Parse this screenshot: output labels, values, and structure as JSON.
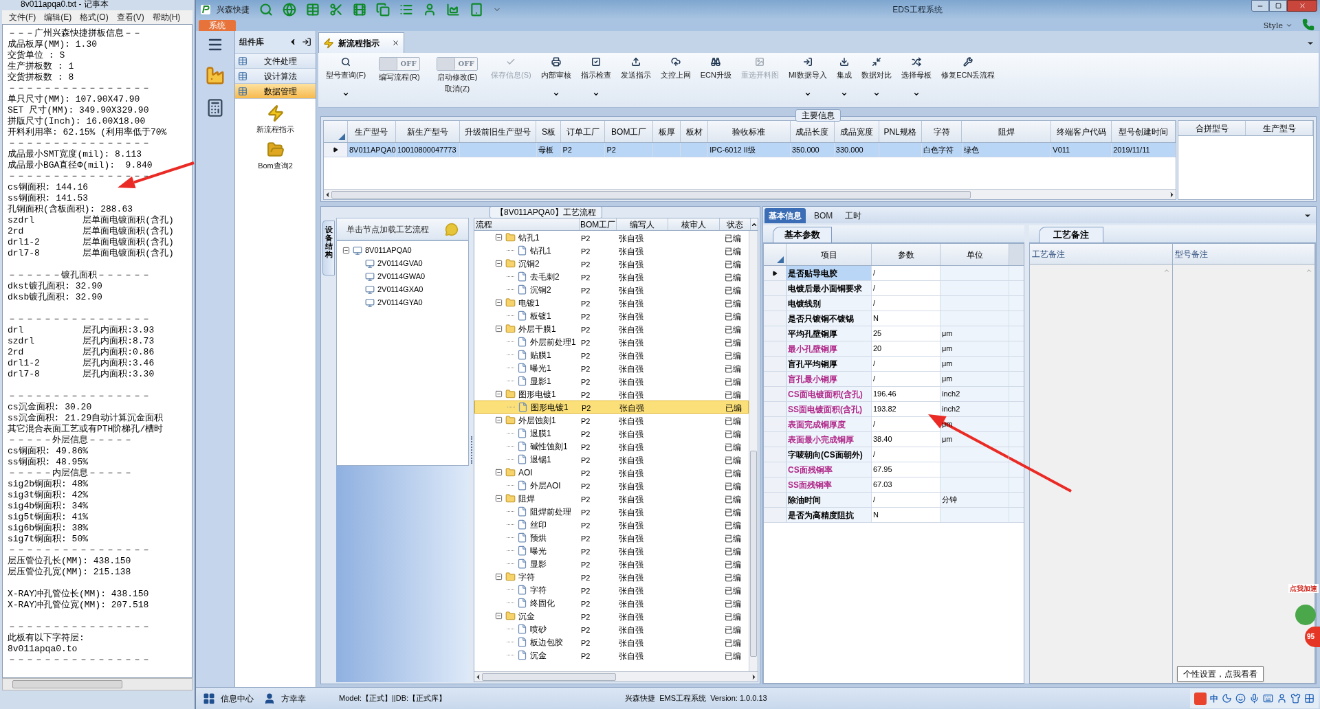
{
  "notepad": {
    "title": "8v011apqa0.txt - 记事本",
    "menu": [
      "文件(F)",
      "编辑(E)",
      "格式(O)",
      "查看(V)",
      "帮助(H)"
    ],
    "blocks": [
      [
        "－－－广州兴森快捷拼板信息－－",
        "成品板厚(MM): 1.30",
        "交货单位 : S",
        "生产拼板数 : 1",
        "交货拼板数 : 8",
        "－－－－－－－－－－－－－－－－",
        "单只尺寸(MM): 107.90X47.90",
        "SET 尺寸(MM): 349.90X329.90",
        "拼版尺寸(Inch): 16.00X18.00",
        "开料利用率: 62.15% (利用率低于70%",
        "－－－－－－－－－－－－－－－－",
        "成品最小SMT宽度(mil): 8.113",
        "成品最小BGA直径Φ(mil):  9.840",
        "－－－－－－－－－－－－－－－－",
        "cs铜面积: 144.16",
        "ss铜面积: 141.53",
        "孔铜面积(含板面积): 288.63",
        "szdrl         层单面电镀面积(含孔)",
        "2rd           层单面电镀面积(含孔)",
        "drl1-2        层单面电镀面积(含孔)",
        "drl7-8        层单面电镀面积(含孔)"
      ],
      [
        "－－－－－－镀孔面积－－－－－－",
        "dkst镀孔面积: 32.90",
        "dksb镀孔面积: 32.90"
      ],
      [
        "－－－－－－－－－－－－－－－－",
        "drl           层孔内面积:3.93",
        "szdrl         层孔内面积:8.73",
        "2rd           层孔内面积:0.86",
        "drl1-2        层孔内面积:3.46",
        "drl7-8        层孔内面积:3.30"
      ],
      [
        "－－－－－－－－－－－－－－－－",
        "cs沉金面积: 30.20",
        "ss沉金面积: 21.29自动计算沉金面积",
        "其它混合表面工艺或有PTH阶梯孔/槽时",
        "－－－－－外层信息－－－－－",
        "cs铜面积: 49.86%",
        "ss铜面积: 48.95%",
        "－－－－－内层信息－－－－－",
        "sig2b铜面积: 48%",
        "sig3t铜面积: 42%",
        "sig4b铜面积: 34%",
        "sig5t铜面积: 41%",
        "sig6b铜面积: 38%",
        "sig7t铜面积: 50%",
        "－－－－－－－－－－－－－－－－",
        "层压管位孔长(MM): 438.150",
        "层压管位孔宽(MM): 215.138"
      ],
      [
        "X-RAY冲孔管位长(MM): 438.150",
        "X-RAY冲孔管位宽(MM): 207.518"
      ],
      [
        "－－－－－－－－－－－－－－－－",
        "此板有以下字符层:",
        "8v011apqa0.to",
        "－－－－－－－－－－－－－－－－"
      ]
    ]
  },
  "app": {
    "title": "兴森快捷",
    "caption": "EDS工程系统",
    "system_tab": "系统",
    "style_menu": "Style"
  },
  "component_library": {
    "title": "组件库",
    "categories": [
      {
        "label": "文件处理",
        "selected": false
      },
      {
        "label": "设计算法",
        "selected": false
      },
      {
        "label": "数据管理",
        "selected": true
      }
    ],
    "tools": [
      "新流程指示",
      "Bom查询2"
    ]
  },
  "document_tab": {
    "label": "新流程指示"
  },
  "ribbon": [
    {
      "kind": "button",
      "label": "型号查询(F)",
      "dropdown": true,
      "disabled": false
    },
    {
      "kind": "toggle",
      "label": "编写流程(R)",
      "text": "OFF",
      "on": false
    },
    {
      "kind": "toggle",
      "label": "启动修改(E)",
      "sublabel": "取消(Z)",
      "text": "OFF",
      "on": false
    },
    {
      "kind": "button",
      "label": "保存信息(S)",
      "dropdown": false,
      "disabled": true
    },
    {
      "kind": "button",
      "label": "内部审核",
      "dropdown": true,
      "disabled": false
    },
    {
      "kind": "button",
      "label": "指示检查",
      "dropdown": true,
      "disabled": false
    },
    {
      "kind": "button",
      "label": "发送指示",
      "dropdown": false,
      "disabled": false
    },
    {
      "kind": "button",
      "label": "文控上网",
      "dropdown": false,
      "disabled": false
    },
    {
      "kind": "button",
      "label": "ECN升级",
      "dropdown": false,
      "disabled": false
    },
    {
      "kind": "button",
      "label": "重选开料图",
      "dropdown": false,
      "disabled": true
    },
    {
      "kind": "button",
      "label": "MI数据导入",
      "dropdown": true,
      "disabled": false
    },
    {
      "kind": "button",
      "label": "集成",
      "dropdown": true,
      "disabled": false
    },
    {
      "kind": "button",
      "label": "数据对比",
      "dropdown": true,
      "disabled": false
    },
    {
      "kind": "button",
      "label": "选择母板",
      "dropdown": true,
      "disabled": false
    },
    {
      "kind": "button",
      "label": "修复ECN丢流程",
      "dropdown": false,
      "disabled": false
    }
  ],
  "main_info": {
    "caption": "主要信息",
    "columns": [
      "生产型号",
      "新生产型号",
      "升级前旧生产型号",
      "S板",
      "订单工厂",
      "BOM工厂",
      "板厚",
      "板材",
      "验收标准",
      "成品长度",
      "成品宽度",
      "PNL规格",
      "字符",
      "阻焊",
      "终端客户代码",
      "型号创建时间"
    ],
    "rows": [
      {
        "selected": true,
        "cells": [
          "8V011APQA0",
          "10010800047773",
          null,
          "母板",
          "P2",
          "P2",
          null,
          null,
          "IPC-6012 II级",
          "350.000",
          "330.000",
          null,
          "白色字符",
          "绿色",
          "V011",
          "2019/11/11"
        ]
      }
    ],
    "side_columns": [
      "合拼型号",
      "生产型号"
    ]
  },
  "process": {
    "caption": "【8V011APQA0】工艺流程",
    "side_tab": "设备结构",
    "hint": "单击节点加载工艺流程",
    "tree": [
      {
        "label": "8V011APQA0",
        "expanded": true,
        "children": [
          {
            "label": "2V0114GVA0"
          },
          {
            "label": "2V0114GWA0"
          },
          {
            "label": "2V0114GXA0"
          },
          {
            "label": "2V0114GYA0"
          }
        ]
      }
    ],
    "columns": [
      "流程",
      "BOM工厂",
      "编写人",
      "核审人",
      "状态"
    ],
    "steps": [
      {
        "name": "钻孔1",
        "expanded": true,
        "selected": false,
        "bom": "P2",
        "writer": "张自强",
        "status": "已编",
        "children": [
          {
            "name": "钻孔1",
            "selected": false,
            "bom": "P2",
            "writer": "张自强",
            "status": "已编"
          }
        ]
      },
      {
        "name": "沉铜2",
        "expanded": true,
        "selected": false,
        "bom": "P2",
        "writer": "张自强",
        "status": "已编",
        "children": [
          {
            "name": "去毛刺2",
            "selected": false,
            "bom": "P2",
            "writer": "张自强",
            "status": "已编"
          },
          {
            "name": "沉铜2",
            "selected": false,
            "bom": "P2",
            "writer": "张自强",
            "status": "已编"
          }
        ]
      },
      {
        "name": "电镀1",
        "expanded": true,
        "selected": false,
        "bom": "P2",
        "writer": "张自强",
        "status": "已编",
        "children": [
          {
            "name": "板镀1",
            "selected": false,
            "bom": "P2",
            "writer": "张自强",
            "status": "已编"
          }
        ]
      },
      {
        "name": "外层干膜1",
        "expanded": true,
        "selected": false,
        "bom": "P2",
        "writer": "张自强",
        "status": "已编",
        "children": [
          {
            "name": "外层前处理1",
            "selected": false,
            "bom": "P2",
            "writer": "张自强",
            "status": "已编"
          },
          {
            "name": "贴膜1",
            "selected": false,
            "bom": "P2",
            "writer": "张自强",
            "status": "已编"
          },
          {
            "name": "曝光1",
            "selected": false,
            "bom": "P2",
            "writer": "张自强",
            "status": "已编"
          },
          {
            "name": "显影1",
            "selected": false,
            "bom": "P2",
            "writer": "张自强",
            "status": "已编"
          }
        ]
      },
      {
        "name": "图形电镀1",
        "expanded": true,
        "selected": false,
        "bom": "P2",
        "writer": "张自强",
        "status": "已编",
        "children": [
          {
            "name": "图形电镀1",
            "selected": true,
            "bom": "P2",
            "writer": "张自强",
            "status": "已编"
          }
        ]
      },
      {
        "name": "外层蚀刻1",
        "expanded": true,
        "selected": false,
        "bom": "P2",
        "writer": "张自强",
        "status": "已编",
        "children": [
          {
            "name": "退膜1",
            "selected": false,
            "bom": "P2",
            "writer": "张自强",
            "status": "已编"
          },
          {
            "name": "碱性蚀刻1",
            "selected": false,
            "bom": "P2",
            "writer": "张自强",
            "status": "已编"
          },
          {
            "name": "退锡1",
            "selected": false,
            "bom": "P2",
            "writer": "张自强",
            "status": "已编"
          }
        ]
      },
      {
        "name": "AOI",
        "expanded": true,
        "selected": false,
        "bom": "P2",
        "writer": "张自强",
        "status": "已编",
        "children": [
          {
            "name": "外层AOI",
            "selected": false,
            "bom": "P2",
            "writer": "张自强",
            "status": "已编"
          }
        ]
      },
      {
        "name": "阻焊",
        "expanded": true,
        "selected": false,
        "bom": "P2",
        "writer": "张自强",
        "status": "已编",
        "children": [
          {
            "name": "阻焊前处理",
            "selected": false,
            "bom": "P2",
            "writer": "张自强",
            "status": "已编"
          },
          {
            "name": "丝印",
            "selected": false,
            "bom": "P2",
            "writer": "张自强",
            "status": "已编"
          },
          {
            "name": "预烘",
            "selected": false,
            "bom": "P2",
            "writer": "张自强",
            "status": "已编"
          },
          {
            "name": "曝光",
            "selected": false,
            "bom": "P2",
            "writer": "张自强",
            "status": "已编"
          },
          {
            "name": "显影",
            "selected": false,
            "bom": "P2",
            "writer": "张自强",
            "status": "已编"
          }
        ]
      },
      {
        "name": "字符",
        "expanded": true,
        "selected": false,
        "bom": "P2",
        "writer": "张自强",
        "status": "已编",
        "children": [
          {
            "name": "字符",
            "selected": false,
            "bom": "P2",
            "writer": "张自强",
            "status": "已编"
          },
          {
            "name": "终固化",
            "selected": false,
            "bom": "P2",
            "writer": "张自强",
            "status": "已编"
          }
        ]
      },
      {
        "name": "沉金",
        "expanded": true,
        "selected": false,
        "bom": "P2",
        "writer": "张自强",
        "status": "已编",
        "children": [
          {
            "name": "喷砂",
            "selected": false,
            "bom": "P2",
            "writer": "张自强",
            "status": "已编"
          },
          {
            "name": "板边包胶",
            "selected": false,
            "bom": "P2",
            "writer": "张自强",
            "status": "已编"
          },
          {
            "name": "沉金",
            "selected": false,
            "bom": "P2",
            "writer": "张自强",
            "status": "已编"
          }
        ]
      }
    ]
  },
  "details": {
    "tabs": [
      {
        "label": "基本信息",
        "selected": true
      },
      {
        "label": "BOM",
        "selected": false
      },
      {
        "label": "工时",
        "selected": false
      }
    ],
    "params_tab": "基本参数",
    "param_columns": [
      "项目",
      "参数",
      "单位"
    ],
    "params": [
      {
        "item": "是否贴导电胶",
        "value": "/",
        "color": "#000000",
        "selected": true
      },
      {
        "item": "电镀后最小面铜要求",
        "value": "/",
        "color": "#000000",
        "selected": false
      },
      {
        "item": "电镀线别",
        "value": "/",
        "color": "#000000",
        "selected": false
      },
      {
        "item": "是否只镀铜不镀锡",
        "value": "N",
        "color": "#000000",
        "selected": false
      },
      {
        "item": "平均孔壁铜厚",
        "value": "25",
        "unit": "μm",
        "color": "#000000",
        "selected": false
      },
      {
        "item": "最小孔壁铜厚",
        "value": "20",
        "unit": "μm",
        "color": "#b02a8a",
        "selected": false
      },
      {
        "item": "盲孔平均铜厚",
        "value": "/",
        "unit": "μm",
        "color": "#000000",
        "selected": false
      },
      {
        "item": "盲孔最小铜厚",
        "value": "/",
        "unit": "μm",
        "color": "#b02a8a",
        "selected": false
      },
      {
        "item": "CS面电镀面积(含孔)",
        "value": "196.46",
        "unit": "inch2",
        "color": "#b02a8a",
        "selected": false
      },
      {
        "item": "SS面电镀面积(含孔)",
        "value": "193.82",
        "unit": "inch2",
        "color": "#b02a8a",
        "selected": false
      },
      {
        "item": "表面完成铜厚度",
        "value": "/",
        "unit": "μm",
        "color": "#b02a8a",
        "selected": false
      },
      {
        "item": "表面最小完成铜厚",
        "value": "38.40",
        "unit": "μm",
        "color": "#b02a8a",
        "selected": false
      },
      {
        "item": "字唛朝向(CS面朝外)",
        "value": "/",
        "color": "#000000",
        "selected": false
      },
      {
        "item": "CS面残铜率",
        "value": "67.95",
        "color": "#b02a8a",
        "selected": false
      },
      {
        "item": "SS面残铜率",
        "value": "67.03",
        "color": "#b02a8a",
        "selected": false
      },
      {
        "item": "除油时间",
        "value": "/",
        "unit": "分钟",
        "color": "#000000",
        "selected": false
      },
      {
        "item": "是否为高精度阻抗",
        "value": "N",
        "color": "#000000",
        "selected": false
      }
    ],
    "notes_tab": "工艺备注",
    "note_columns": [
      "工艺备注",
      "型号备注"
    ]
  },
  "status_bar": {
    "info_center": "信息中心",
    "user": "方幸幸",
    "model": "Model:【正式】||DB:【正式库】",
    "product": "兴森快捷  EMS工程系统  Version: 1.0.0.13"
  },
  "tray": {
    "ime": "中",
    "tooltip": "个性设置，点我看看",
    "boost": "点我加速",
    "badge": "95"
  }
}
